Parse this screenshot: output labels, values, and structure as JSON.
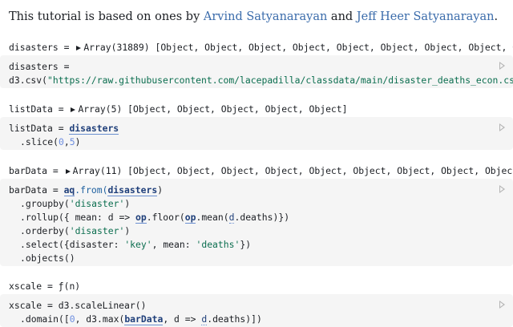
{
  "intro": {
    "prefix": "This tutorial is based on ones by ",
    "link1": "Arvind Satyanarayan",
    "middle": " and ",
    "link2": "Jeff Heer Satyanarayan",
    "suffix": "."
  },
  "cells": {
    "disasters": {
      "output_name": "disasters",
      "output_eq": " = ",
      "output_type": "Array(31889)",
      "output_preview": " [Object, Object, Object, Object, Object, Object, Object, Object, Object, Object, Objec",
      "code": {
        "l1": "disasters =",
        "l2_a": "d3",
        "l2_b": ".csv(",
        "l2_str": "\"https://raw.githubusercontent.com/lacepadilla/classdata/main/disaster_deaths_econ.csv\"",
        "l2_c": ")"
      }
    },
    "listData": {
      "output_name": "listData",
      "output_eq": " = ",
      "output_type": "Array(5)",
      "output_preview": " [Object, Object, Object, Object, Object]",
      "code": {
        "l1_a": "listData = ",
        "l1_ref": "disasters",
        "l2_a": ".slice(",
        "l2_n1": "0",
        "l2_comma": ",",
        "l2_n2": "5",
        "l2_b": ")"
      }
    },
    "barData": {
      "output_name": "barData",
      "output_eq": " = ",
      "output_type": "Array(11)",
      "output_preview": " [Object, Object, Object, Object, Object, Object, Object, Object, Object, Ob",
      "code": {
        "l1_a": "barData = ",
        "l1_aq": "aq",
        "l1_b": ".from(",
        "l1_ref": "disasters",
        "l1_c": ")",
        "l2_a": ".groupby(",
        "l2_str": "'disaster'",
        "l2_b": ")",
        "l3_a": ".rollup({ mean: d => ",
        "l3_op1": "op",
        "l3_b": ".floor(",
        "l3_op2": "op",
        "l3_c": ".mean(",
        "l3_d": "d",
        "l3_e": ".deaths)})",
        "l4_a": ".orderby(",
        "l4_str": "'disaster'",
        "l4_b": ")",
        "l5_a": ".select({disaster: ",
        "l5_s1": "'key'",
        "l5_b": ", mean: ",
        "l5_s2": "'deaths'",
        "l5_c": "})",
        "l6": ".objects()"
      }
    },
    "xscale": {
      "output_name": "xscale",
      "output_eq": " = ",
      "output_value": "ƒ(n)",
      "code": {
        "l1_a": "xscale = ",
        "l1_b": "d3",
        "l1_c": ".scaleLinear()",
        "l2_a": ".domain([",
        "l2_n": "0",
        "l2_b": ", d3.max(",
        "l2_ref": "barData",
        "l2_c": ", d => ",
        "l2_d": "d",
        "l2_e": ".deaths)])"
      }
    }
  },
  "colors": {
    "link": "#3b6cab",
    "cell_background": "#f5f5f5",
    "string": "#0b6e4f",
    "number": "#6d8ee0"
  },
  "icons": {
    "run": "play-triangle-icon",
    "expand": "caret-right-icon"
  }
}
